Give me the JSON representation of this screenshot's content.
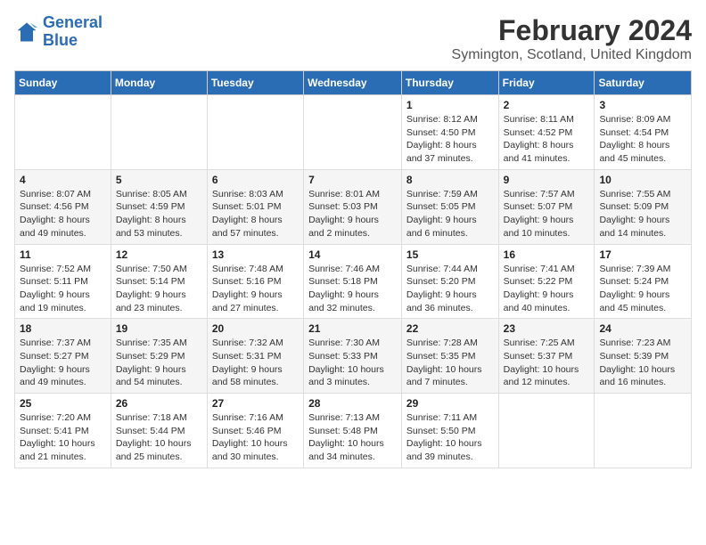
{
  "logo": {
    "line1": "General",
    "line2": "Blue"
  },
  "title": "February 2024",
  "location": "Symington, Scotland, United Kingdom",
  "days_of_week": [
    "Sunday",
    "Monday",
    "Tuesday",
    "Wednesday",
    "Thursday",
    "Friday",
    "Saturday"
  ],
  "weeks": [
    [
      {
        "day": "",
        "info": ""
      },
      {
        "day": "",
        "info": ""
      },
      {
        "day": "",
        "info": ""
      },
      {
        "day": "",
        "info": ""
      },
      {
        "day": "1",
        "info": "Sunrise: 8:12 AM\nSunset: 4:50 PM\nDaylight: 8 hours\nand 37 minutes."
      },
      {
        "day": "2",
        "info": "Sunrise: 8:11 AM\nSunset: 4:52 PM\nDaylight: 8 hours\nand 41 minutes."
      },
      {
        "day": "3",
        "info": "Sunrise: 8:09 AM\nSunset: 4:54 PM\nDaylight: 8 hours\nand 45 minutes."
      }
    ],
    [
      {
        "day": "4",
        "info": "Sunrise: 8:07 AM\nSunset: 4:56 PM\nDaylight: 8 hours\nand 49 minutes."
      },
      {
        "day": "5",
        "info": "Sunrise: 8:05 AM\nSunset: 4:59 PM\nDaylight: 8 hours\nand 53 minutes."
      },
      {
        "day": "6",
        "info": "Sunrise: 8:03 AM\nSunset: 5:01 PM\nDaylight: 8 hours\nand 57 minutes."
      },
      {
        "day": "7",
        "info": "Sunrise: 8:01 AM\nSunset: 5:03 PM\nDaylight: 9 hours\nand 2 minutes."
      },
      {
        "day": "8",
        "info": "Sunrise: 7:59 AM\nSunset: 5:05 PM\nDaylight: 9 hours\nand 6 minutes."
      },
      {
        "day": "9",
        "info": "Sunrise: 7:57 AM\nSunset: 5:07 PM\nDaylight: 9 hours\nand 10 minutes."
      },
      {
        "day": "10",
        "info": "Sunrise: 7:55 AM\nSunset: 5:09 PM\nDaylight: 9 hours\nand 14 minutes."
      }
    ],
    [
      {
        "day": "11",
        "info": "Sunrise: 7:52 AM\nSunset: 5:11 PM\nDaylight: 9 hours\nand 19 minutes."
      },
      {
        "day": "12",
        "info": "Sunrise: 7:50 AM\nSunset: 5:14 PM\nDaylight: 9 hours\nand 23 minutes."
      },
      {
        "day": "13",
        "info": "Sunrise: 7:48 AM\nSunset: 5:16 PM\nDaylight: 9 hours\nand 27 minutes."
      },
      {
        "day": "14",
        "info": "Sunrise: 7:46 AM\nSunset: 5:18 PM\nDaylight: 9 hours\nand 32 minutes."
      },
      {
        "day": "15",
        "info": "Sunrise: 7:44 AM\nSunset: 5:20 PM\nDaylight: 9 hours\nand 36 minutes."
      },
      {
        "day": "16",
        "info": "Sunrise: 7:41 AM\nSunset: 5:22 PM\nDaylight: 9 hours\nand 40 minutes."
      },
      {
        "day": "17",
        "info": "Sunrise: 7:39 AM\nSunset: 5:24 PM\nDaylight: 9 hours\nand 45 minutes."
      }
    ],
    [
      {
        "day": "18",
        "info": "Sunrise: 7:37 AM\nSunset: 5:27 PM\nDaylight: 9 hours\nand 49 minutes."
      },
      {
        "day": "19",
        "info": "Sunrise: 7:35 AM\nSunset: 5:29 PM\nDaylight: 9 hours\nand 54 minutes."
      },
      {
        "day": "20",
        "info": "Sunrise: 7:32 AM\nSunset: 5:31 PM\nDaylight: 9 hours\nand 58 minutes."
      },
      {
        "day": "21",
        "info": "Sunrise: 7:30 AM\nSunset: 5:33 PM\nDaylight: 10 hours\nand 3 minutes."
      },
      {
        "day": "22",
        "info": "Sunrise: 7:28 AM\nSunset: 5:35 PM\nDaylight: 10 hours\nand 7 minutes."
      },
      {
        "day": "23",
        "info": "Sunrise: 7:25 AM\nSunset: 5:37 PM\nDaylight: 10 hours\nand 12 minutes."
      },
      {
        "day": "24",
        "info": "Sunrise: 7:23 AM\nSunset: 5:39 PM\nDaylight: 10 hours\nand 16 minutes."
      }
    ],
    [
      {
        "day": "25",
        "info": "Sunrise: 7:20 AM\nSunset: 5:41 PM\nDaylight: 10 hours\nand 21 minutes."
      },
      {
        "day": "26",
        "info": "Sunrise: 7:18 AM\nSunset: 5:44 PM\nDaylight: 10 hours\nand 25 minutes."
      },
      {
        "day": "27",
        "info": "Sunrise: 7:16 AM\nSunset: 5:46 PM\nDaylight: 10 hours\nand 30 minutes."
      },
      {
        "day": "28",
        "info": "Sunrise: 7:13 AM\nSunset: 5:48 PM\nDaylight: 10 hours\nand 34 minutes."
      },
      {
        "day": "29",
        "info": "Sunrise: 7:11 AM\nSunset: 5:50 PM\nDaylight: 10 hours\nand 39 minutes."
      },
      {
        "day": "",
        "info": ""
      },
      {
        "day": "",
        "info": ""
      }
    ]
  ]
}
